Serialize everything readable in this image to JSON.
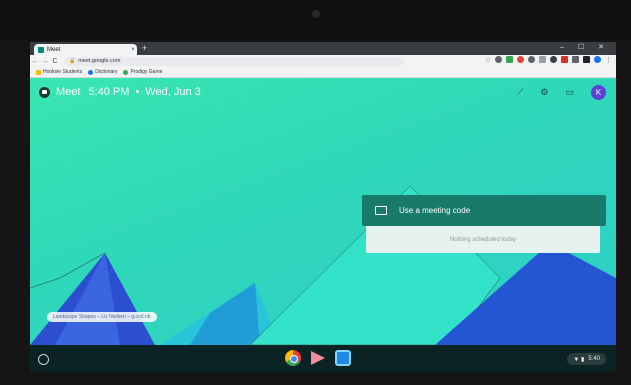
{
  "browser": {
    "tab_title": "Meet",
    "tab_close": "×",
    "new_tab": "+",
    "window_controls": "– ☐ ✕",
    "url": "meet.google.com",
    "nav": {
      "back": "←",
      "forward": "→",
      "reload": "C"
    }
  },
  "bookmarks": [
    {
      "label": "Hooksie Students",
      "color": "#fbbc05"
    },
    {
      "label": "Dictionary",
      "color": "#1a73e8"
    },
    {
      "label": "Prodigy Game",
      "color": "#34a853"
    }
  ],
  "meet": {
    "app_name": "Meet",
    "time": "5:40 PM",
    "separator": "•",
    "date": "Wed, Jun 3",
    "avatar_initial": "K",
    "use_meeting_code": "Use a meeting code",
    "nothing_scheduled": "Nothing scheduled today",
    "wallpaper_credit": "Landscape Shapes – Liz Nielsen – g.co/Lnb"
  },
  "shelf": {
    "time": "5:40",
    "status_glyphs": "▼ ▮"
  },
  "icons": {
    "header": [
      "trend-icon",
      "settings-icon",
      "feedback-icon"
    ],
    "extensions": [
      "star-icon",
      "ext-icons"
    ]
  }
}
